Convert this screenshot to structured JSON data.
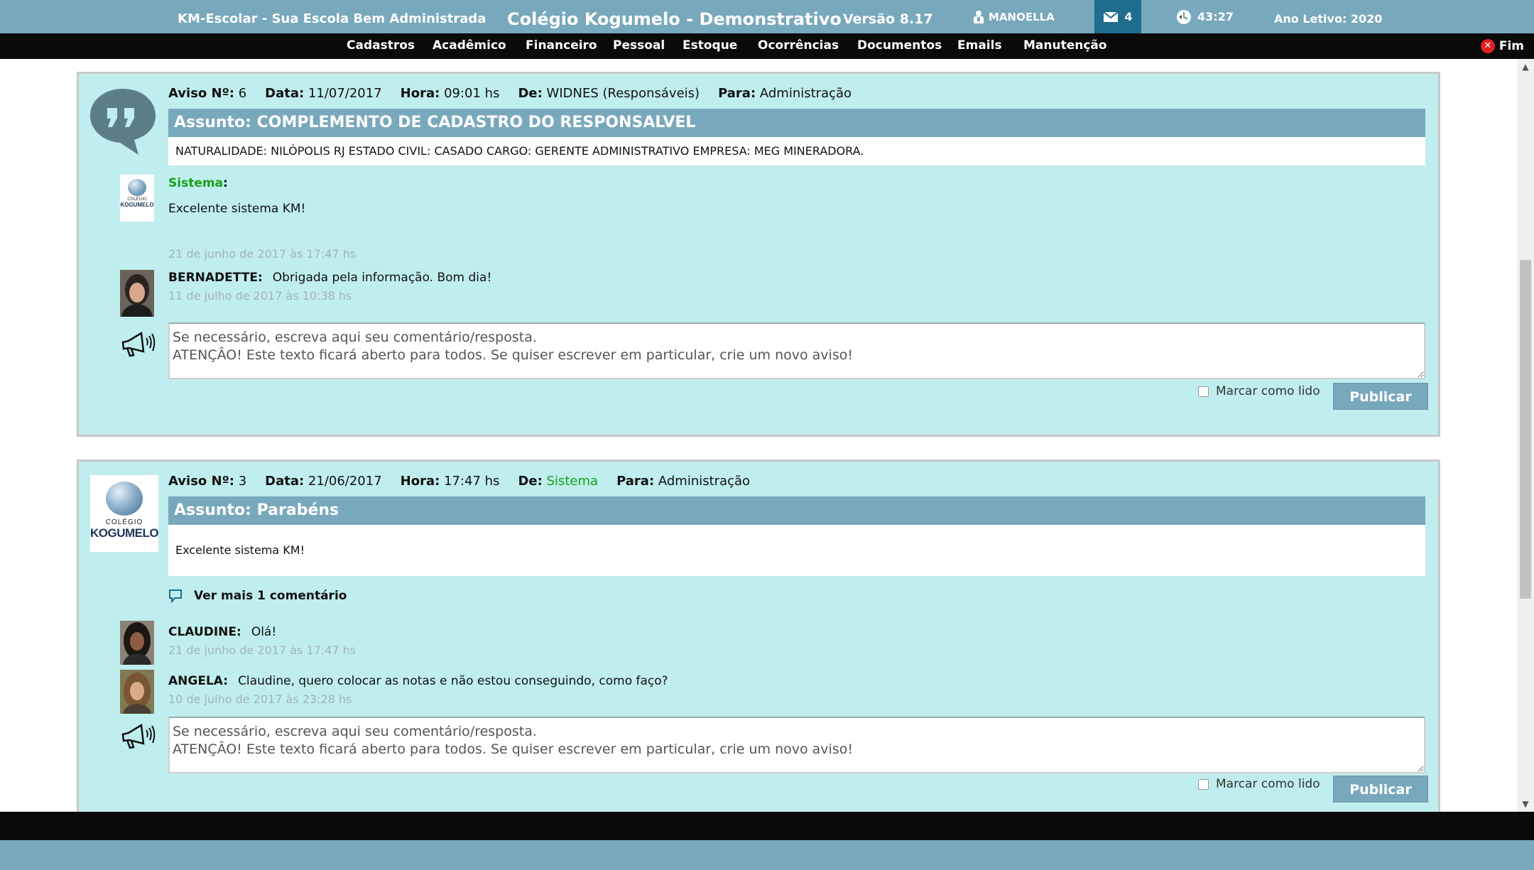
{
  "header": {
    "app_name": "KM-Escolar - Sua Escola Bem Administrada",
    "school_name": "Colégio Kogumelo - Demonstrativo",
    "version": "Versão 8.17",
    "user": "MANOELLA",
    "mail_count": "4",
    "session_time": "43:27",
    "school_year": "Ano Letivo: 2020",
    "icons": {
      "user": "user-icon",
      "mail": "mail-icon",
      "clock": "clock-icon"
    },
    "colors": {
      "bar": "#78a8bb",
      "mail_bg": "#1f6d8c"
    }
  },
  "menu": {
    "items": [
      "Cadastros",
      "Acadêmico",
      "Financeiro",
      "Pessoal",
      "Estoque",
      "Ocorrências",
      "Documentos",
      "Emails",
      "Manutenção"
    ],
    "logout": "Fim"
  },
  "notices": [
    {
      "labels": {
        "number": "Aviso Nº:",
        "date": "Data:",
        "hour": "Hora:",
        "from": "De:",
        "to": "Para:"
      },
      "number": "6",
      "date": "11/07/2017",
      "hour": "09:01 hs",
      "from": "WIDNES (Responsáveis)",
      "to": "Administração",
      "subject": "Assunto: COMPLEMENTO DE CADASTRO DO RESPONSALVEL",
      "body": "NATURALIDADE: NILÓPOLIS RJ ESTADO CIVIL: CASADO CARGO: GERENTE ADMINISTRATIVO EMPRESA: MEG MINERADORA.",
      "system_comment": {
        "author": "Sistema",
        "text": "Excelente sistema KM!",
        "date": "21 de junho de 2017 às 17:47 hs"
      },
      "comments": [
        {
          "author": "BERNADETTE:",
          "text": "Obrigada pela informação. Bom dia!",
          "date": "11 de julho de 2017 às 10:38 hs"
        }
      ],
      "reply_placeholder": "Se necessário, escreva aqui seu comentário/resposta.\nATENÇÂO! Este texto ficará aberto para todos. Se quiser escrever em particular, crie um novo aviso!",
      "mark_read": "Marcar como lido",
      "publish": "Publicar"
    },
    {
      "labels": {
        "number": "Aviso Nº:",
        "date": "Data:",
        "hour": "Hora:",
        "from": "De:",
        "to": "Para:"
      },
      "number": "3",
      "date": "21/06/2017",
      "hour": "17:47 hs",
      "from": "Sistema",
      "to": "Administração",
      "subject": "Assunto: Parabéns",
      "body": "Excelente sistema KM!",
      "logo": {
        "top": "COLÉGIO",
        "main": "KOGUMELO"
      },
      "more_comments": "Ver mais 1 comentário",
      "comments": [
        {
          "author": "CLAUDINE:",
          "text": "Olá!",
          "date": "21 de junho de 2017 às 17:47 hs"
        },
        {
          "author": "ANGELA:",
          "text": "Claudine, quero colocar as notas e não estou conseguindo, como faço?",
          "date": "10 de julho de 2017 às 23:28 hs"
        }
      ],
      "reply_placeholder": "Se necessário, escreva aqui seu comentário/resposta.\nATENÇÂO! Este texto ficará aberto para todos. Se quiser escrever em particular, crie um novo aviso!",
      "mark_read": "Marcar como lido",
      "publish": "Publicar"
    }
  ]
}
